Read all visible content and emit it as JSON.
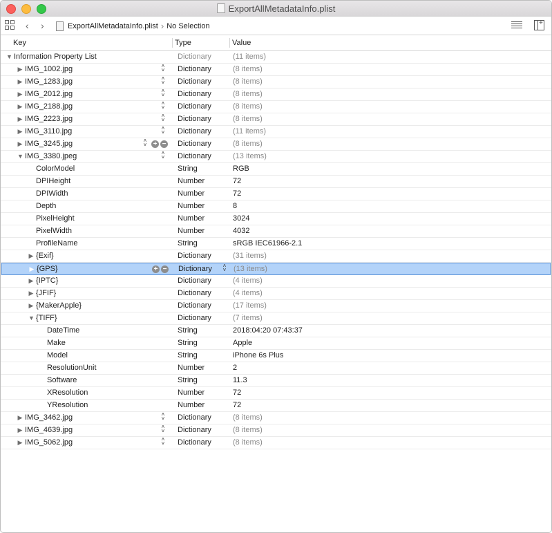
{
  "window": {
    "title": "ExportAllMetadataInfo.plist"
  },
  "jumpbar": {
    "file": "ExportAllMetadataInfo.plist",
    "selection": "No Selection"
  },
  "header": {
    "key": "Key",
    "type": "Type",
    "value": "Value"
  },
  "icons": {
    "grid": "related-items-grid-icon",
    "back": "chevron-left-icon",
    "forward": "chevron-right-icon",
    "editor": "editor-lines-icon",
    "inspector": "inspector-panel-icon"
  },
  "rows": [
    {
      "key": "Information Property List",
      "type": "Dictionary",
      "value": "(11 items)",
      "level": 0,
      "disclosure": "open",
      "type_gray": true,
      "value_gray": true
    },
    {
      "key": "IMG_1002.jpg",
      "type": "Dictionary",
      "value": "(8 items)",
      "level": 1,
      "disclosure": "closed",
      "stepper": true,
      "value_gray": true
    },
    {
      "key": "IMG_1283.jpg",
      "type": "Dictionary",
      "value": "(8 items)",
      "level": 1,
      "disclosure": "closed",
      "stepper": true,
      "value_gray": true
    },
    {
      "key": "IMG_2012.jpg",
      "type": "Dictionary",
      "value": "(8 items)",
      "level": 1,
      "disclosure": "closed",
      "stepper": true,
      "value_gray": true
    },
    {
      "key": "IMG_2188.jpg",
      "type": "Dictionary",
      "value": "(8 items)",
      "level": 1,
      "disclosure": "closed",
      "stepper": true,
      "value_gray": true
    },
    {
      "key": "IMG_2223.jpg",
      "type": "Dictionary",
      "value": "(8 items)",
      "level": 1,
      "disclosure": "closed",
      "stepper": true,
      "value_gray": true
    },
    {
      "key": "IMG_3110.jpg",
      "type": "Dictionary",
      "value": "(11 items)",
      "level": 1,
      "disclosure": "closed",
      "stepper": true,
      "value_gray": true
    },
    {
      "key": "IMG_3245.jpg",
      "type": "Dictionary",
      "value": "(8 items)",
      "level": 1,
      "disclosure": "closed",
      "stepper": true,
      "addremove": true,
      "value_gray": true
    },
    {
      "key": "IMG_3380.jpeg",
      "type": "Dictionary",
      "value": "(13 items)",
      "level": 1,
      "disclosure": "open",
      "stepper": true,
      "value_gray": true
    },
    {
      "key": "ColorModel",
      "type": "String",
      "value": "RGB",
      "level": 2
    },
    {
      "key": "DPIHeight",
      "type": "Number",
      "value": "72",
      "level": 2
    },
    {
      "key": "DPIWidth",
      "type": "Number",
      "value": "72",
      "level": 2
    },
    {
      "key": "Depth",
      "type": "Number",
      "value": "8",
      "level": 2
    },
    {
      "key": "PixelHeight",
      "type": "Number",
      "value": "3024",
      "level": 2
    },
    {
      "key": "PixelWidth",
      "type": "Number",
      "value": "4032",
      "level": 2
    },
    {
      "key": "ProfileName",
      "type": "String",
      "value": "sRGB IEC61966-2.1",
      "level": 2
    },
    {
      "key": "{Exif}",
      "type": "Dictionary",
      "value": "(31 items)",
      "level": 2,
      "disclosure": "closed",
      "value_gray": true
    },
    {
      "key": "{GPS}",
      "type": "Dictionary",
      "value": "(13 items)",
      "level": 2,
      "disclosure": "closed",
      "selected": true,
      "addremove": true,
      "type_stepper": true,
      "value_gray": true
    },
    {
      "key": "{IPTC}",
      "type": "Dictionary",
      "value": "(4 items)",
      "level": 2,
      "disclosure": "closed",
      "value_gray": true
    },
    {
      "key": "{JFIF}",
      "type": "Dictionary",
      "value": "(4 items)",
      "level": 2,
      "disclosure": "closed",
      "value_gray": true
    },
    {
      "key": "{MakerApple}",
      "type": "Dictionary",
      "value": "(17 items)",
      "level": 2,
      "disclosure": "closed",
      "value_gray": true
    },
    {
      "key": "{TIFF}",
      "type": "Dictionary",
      "value": "(7 items)",
      "level": 2,
      "disclosure": "open",
      "value_gray": true
    },
    {
      "key": "DateTime",
      "type": "String",
      "value": "2018:04:20 07:43:37",
      "level": 3
    },
    {
      "key": "Make",
      "type": "String",
      "value": "Apple",
      "level": 3
    },
    {
      "key": "Model",
      "type": "String",
      "value": "iPhone 6s Plus",
      "level": 3
    },
    {
      "key": "ResolutionUnit",
      "type": "Number",
      "value": "2",
      "level": 3
    },
    {
      "key": "Software",
      "type": "String",
      "value": "11.3",
      "level": 3
    },
    {
      "key": "XResolution",
      "type": "Number",
      "value": "72",
      "level": 3
    },
    {
      "key": "YResolution",
      "type": "Number",
      "value": "72",
      "level": 3
    },
    {
      "key": "IMG_3462.jpg",
      "type": "Dictionary",
      "value": "(8 items)",
      "level": 1,
      "disclosure": "closed",
      "stepper": true,
      "value_gray": true
    },
    {
      "key": "IMG_4639.jpg",
      "type": "Dictionary",
      "value": "(8 items)",
      "level": 1,
      "disclosure": "closed",
      "stepper": true,
      "value_gray": true
    },
    {
      "key": "IMG_5062.jpg",
      "type": "Dictionary",
      "value": "(8 items)",
      "level": 1,
      "disclosure": "closed",
      "stepper": true,
      "value_gray": true
    }
  ]
}
